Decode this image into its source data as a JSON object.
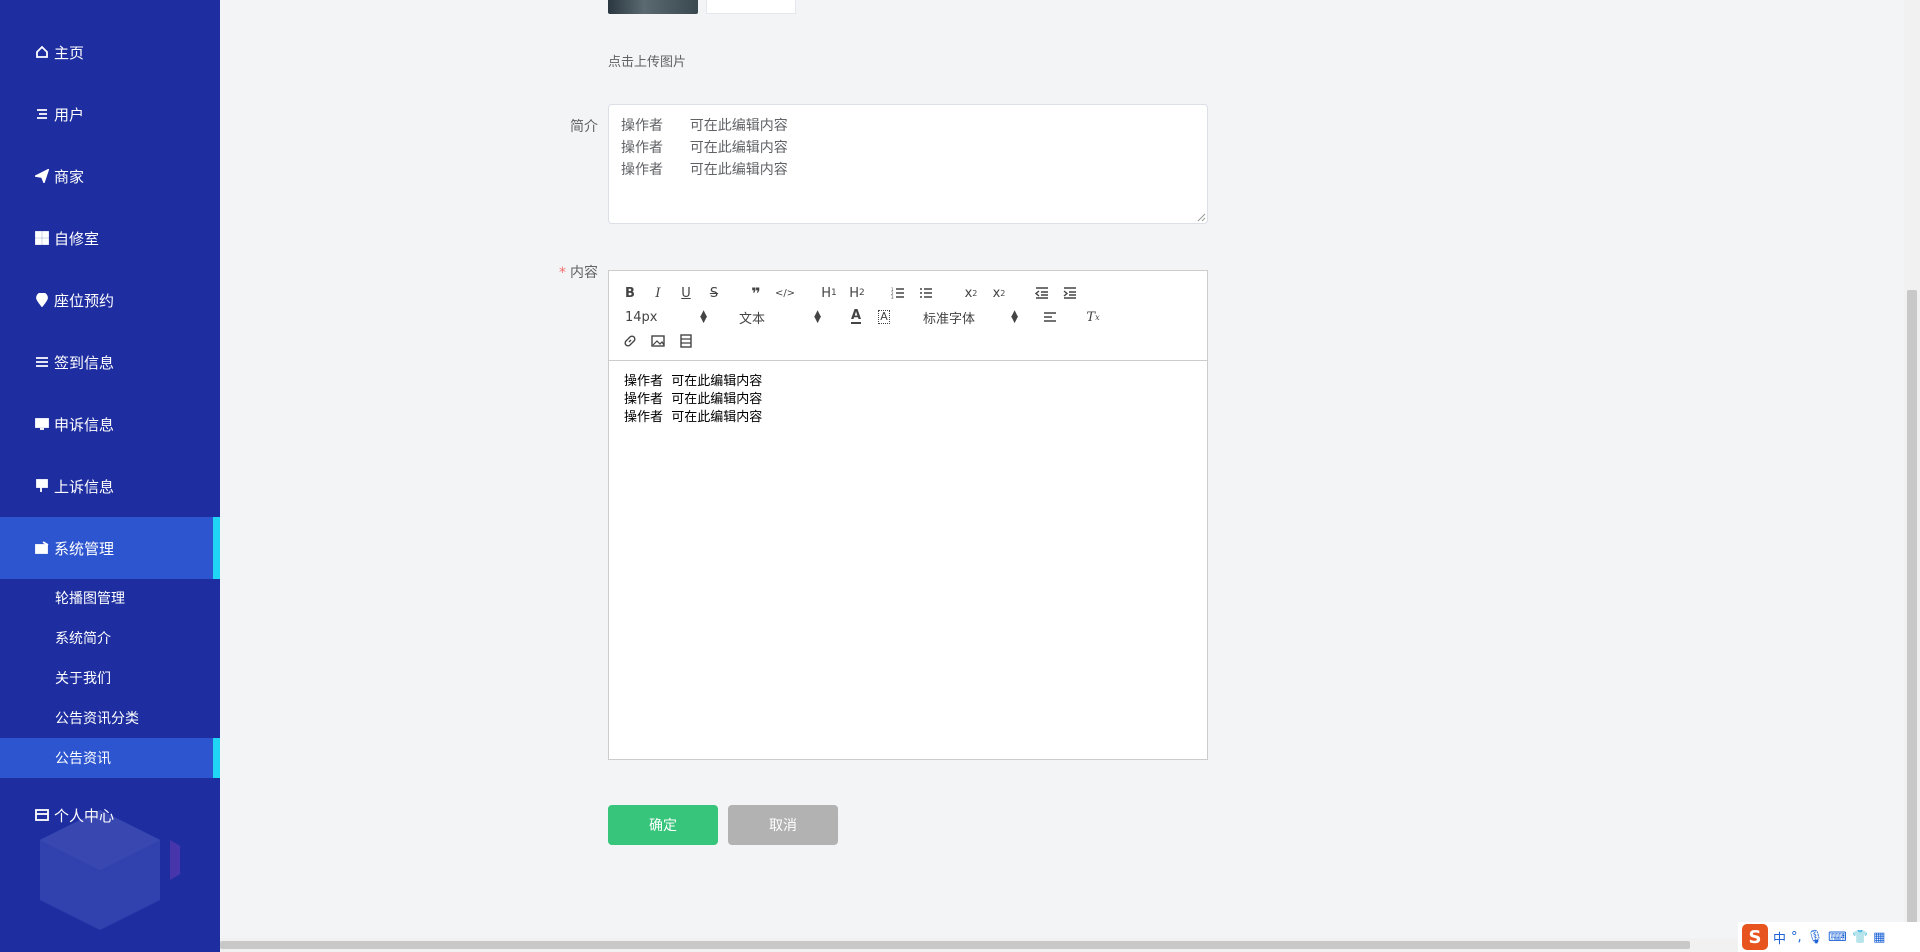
{
  "sidebar": {
    "items": [
      {
        "label": "主页",
        "icon": "home-icon"
      },
      {
        "label": "用户",
        "icon": "list-icon"
      },
      {
        "label": "商家",
        "icon": "paper-plane-icon"
      },
      {
        "label": "自修室",
        "icon": "grid-icon"
      },
      {
        "label": "座位预约",
        "icon": "location-pin-icon"
      },
      {
        "label": "签到信息",
        "icon": "list-icon"
      },
      {
        "label": "申诉信息",
        "icon": "monitor-icon"
      },
      {
        "label": "上诉信息",
        "icon": "thumbs-down-icon"
      },
      {
        "label": "系统管理",
        "icon": "wallet-icon"
      },
      {
        "label": "个人中心",
        "icon": "card-icon"
      }
    ],
    "sub_items": [
      {
        "label": "轮播图管理"
      },
      {
        "label": "系统简介"
      },
      {
        "label": "关于我们"
      },
      {
        "label": "公告资讯分类"
      },
      {
        "label": "公告资讯"
      }
    ],
    "active_item": "系统管理",
    "active_sub_item": "公告资讯"
  },
  "form": {
    "upload_tip": "点击上传图片",
    "intro_label": "简介",
    "intro_value": "操作者      可在此编辑内容\n操作者      可在此编辑内容\n操作者      可在此编辑内容",
    "content_label": "内容",
    "content_required_mark": "*"
  },
  "editor": {
    "font_size": "14px",
    "header_picker": "文本",
    "font_family": "标准字体",
    "content": "操作者  可在此编辑内容\n操作者  可在此编辑内容\n操作者  可在此编辑内容"
  },
  "buttons": {
    "ok_label": "确定",
    "cancel_label": "取消"
  },
  "ime": {
    "logo": "S",
    "lang": "中",
    "punct": "°,"
  },
  "colors": {
    "sidebar_bg": "#1e2ea0",
    "sidebar_active": "#2c55cf",
    "active_indicator": "#1fd6f5",
    "ok_button": "#37c47b",
    "cancel_button": "#b2b2b2"
  }
}
